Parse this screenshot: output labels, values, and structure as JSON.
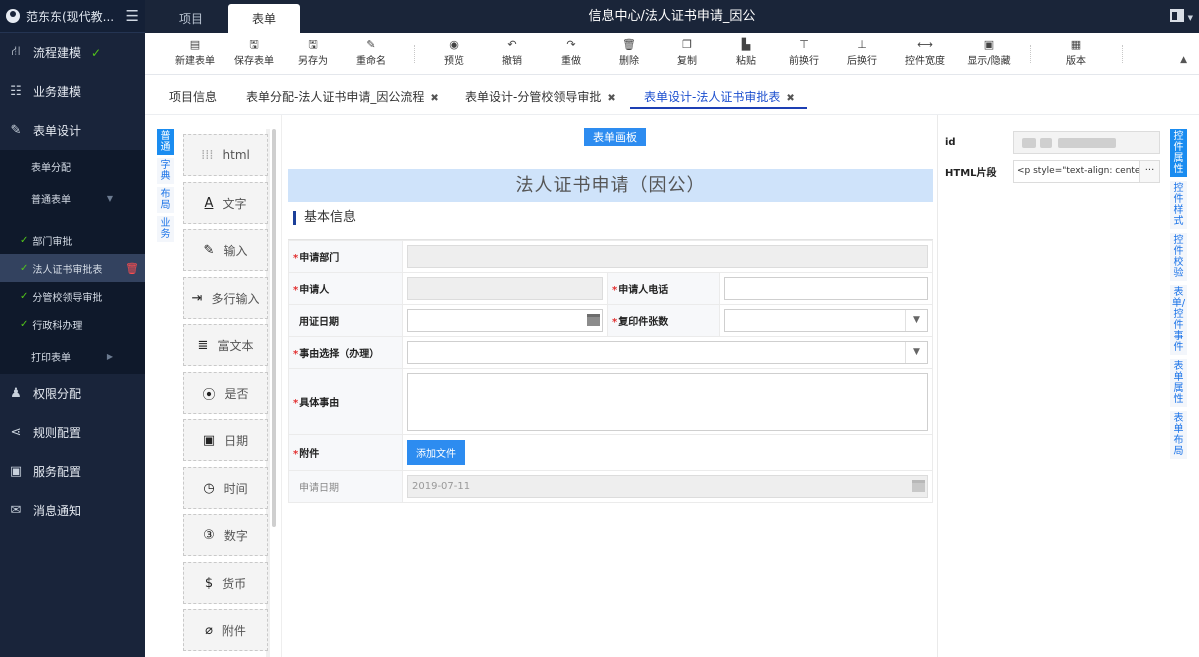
{
  "user": {
    "name": "范东东(现代教..."
  },
  "sidebar": {
    "items": [
      {
        "label": "流程建模",
        "checked": true
      },
      {
        "label": "业务建模"
      },
      {
        "label": "表单设计"
      }
    ],
    "form_sub": {
      "assign": "表单分配",
      "normal": "普通表单",
      "forms": [
        "部门审批",
        "法人证书审批表",
        "分管校领导审批",
        "行政科办理"
      ],
      "print": "打印表单"
    },
    "more": [
      "权限分配",
      "规则配置",
      "服务配置",
      "消息通知"
    ]
  },
  "topbar": {
    "tabs": [
      "项目",
      "表单"
    ],
    "title": "信息中心/法人证书申请_因公"
  },
  "toolbar": {
    "buttons": [
      "新建表单",
      "保存表单",
      "另存为",
      "重命名",
      "预览",
      "撤销",
      "重做",
      "删除",
      "复制",
      "粘贴",
      "前换行",
      "后换行",
      "控件宽度",
      "显示/隐藏",
      "版本"
    ]
  },
  "page_tabs": [
    {
      "label": "项目信息"
    },
    {
      "label": "表单分配-法人证书申请_因公流程"
    },
    {
      "label": "表单设计-分管校领导审批"
    },
    {
      "label": "表单设计-法人证书审批表"
    }
  ],
  "palette": {
    "tabs": [
      "普通",
      "字典",
      "布局",
      "业务"
    ],
    "items": [
      "html",
      "文字",
      "输入",
      "多行输入",
      "富文本",
      "是否",
      "日期",
      "时间",
      "数字",
      "货币",
      "附件"
    ]
  },
  "canvas": {
    "tag": "表单画板",
    "form_title": "法人证书申请（因公）",
    "section": "基本信息",
    "fields": {
      "dept": "申请部门",
      "applicant": "申请人",
      "phone": "申请人电话",
      "use_date": "用证日期",
      "copies": "复印件张数",
      "reason_choice": "事由选择（办理）",
      "reason": "具体事由",
      "attachment": "附件",
      "add_file": "添加文件",
      "apply_date": "申请日期",
      "apply_date_value": "2019-07-11"
    }
  },
  "props": {
    "id_label": "id",
    "html_label": "HTML片段",
    "html_value": "<p style=\"text-align: center",
    "more": "···"
  },
  "right_tabs": [
    "控件属性",
    "控件样式",
    "控件校验",
    "表单/控件事件",
    "表单属性",
    "表单布局"
  ]
}
